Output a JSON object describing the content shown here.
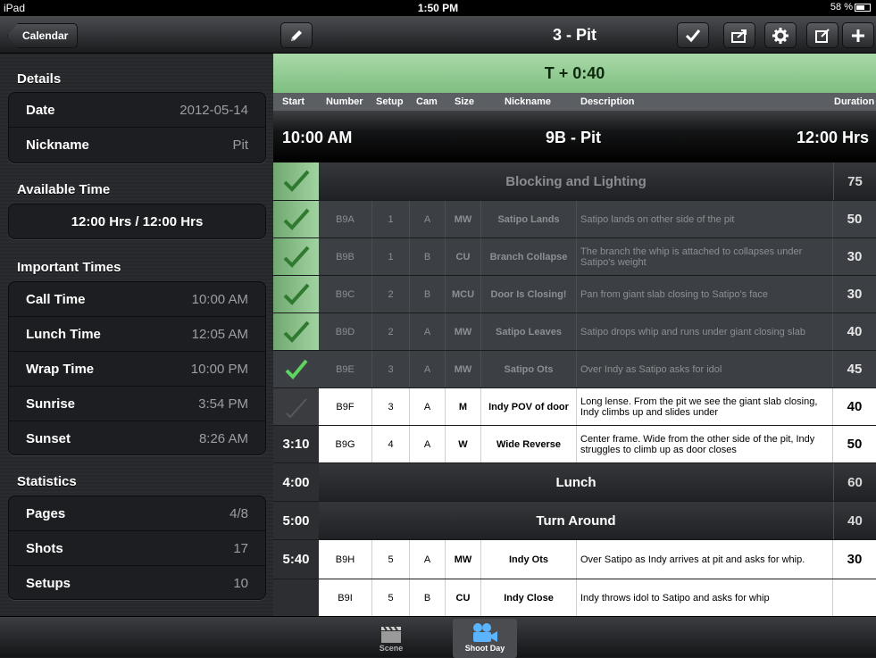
{
  "status": {
    "device": "iPad",
    "time": "1:50 PM",
    "battery": "58 %"
  },
  "sidebar": {
    "back_label": "Calendar",
    "details_header": "Details",
    "details": [
      {
        "label": "Date",
        "value": "2012-05-14"
      },
      {
        "label": "Nickname",
        "value": "Pit"
      }
    ],
    "available_header": "Available Time",
    "available_value": "12:00 Hrs  /  12:00 Hrs",
    "important_header": "Important Times",
    "important": [
      {
        "label": "Call Time",
        "value": "10:00 AM"
      },
      {
        "label": "Lunch Time",
        "value": "12:05 AM"
      },
      {
        "label": "Wrap Time",
        "value": "10:00 PM"
      },
      {
        "label": "Sunrise",
        "value": "3:54 PM"
      },
      {
        "label": "Sunset",
        "value": "8:26 AM"
      }
    ],
    "stats_header": "Statistics",
    "stats": [
      {
        "label": "Pages",
        "value": "4/8"
      },
      {
        "label": "Shots",
        "value": "17"
      },
      {
        "label": "Setups",
        "value": "10"
      }
    ]
  },
  "main": {
    "title": "3 - Pit",
    "timer": "T + 0:40",
    "columns": {
      "start": "Start",
      "number": "Number",
      "setup": "Setup",
      "cam": "Cam",
      "size": "Size",
      "nickname": "Nickname",
      "description": "Description",
      "duration": "Duration"
    },
    "day": {
      "start": "10:00 AM",
      "scene": "9B - Pit",
      "duration": "12:00 Hrs"
    },
    "band_blocking": {
      "label": "Blocking and Lighting",
      "duration": "75"
    },
    "shots": [
      {
        "number": "B9A",
        "setup": "1",
        "cam": "A",
        "size": "MW",
        "nickname": "Satipo Lands",
        "description": "Satipo lands on other side of the pit",
        "duration": "50"
      },
      {
        "number": "B9B",
        "setup": "1",
        "cam": "B",
        "size": "CU",
        "nickname": "Branch Collapse",
        "description": "The branch the whip is attached to collapses under Satipo's weight",
        "duration": "30"
      },
      {
        "number": "B9C",
        "setup": "2",
        "cam": "B",
        "size": "MCU",
        "nickname": "Door Is Closing!",
        "description": "Pan from giant slab closing to Satipo's face",
        "duration": "30"
      },
      {
        "number": "B9D",
        "setup": "2",
        "cam": "A",
        "size": "MW",
        "nickname": "Satipo Leaves",
        "description": "Satipo drops whip and runs under giant closing slab",
        "duration": "40"
      },
      {
        "number": "B9E",
        "setup": "3",
        "cam": "A",
        "size": "MW",
        "nickname": "Satipo Ots",
        "description": "Over Indy as Satipo asks for idol",
        "duration": "45"
      },
      {
        "number": "B9F",
        "setup": "3",
        "cam": "A",
        "size": "M",
        "nickname": "Indy POV of door",
        "description": "Long lense. From the pit we see the giant slab closing, Indy climbs up and slides under",
        "duration": "40"
      },
      {
        "start": "3:10",
        "number": "B9G",
        "setup": "4",
        "cam": "A",
        "size": "W",
        "nickname": "Wide Reverse",
        "description": "Center frame. Wide from the other side of the pit, Indy struggles to climb up as door closes",
        "duration": "50"
      },
      {
        "start": "5:40",
        "number": "B9H",
        "setup": "5",
        "cam": "A",
        "size": "MW",
        "nickname": "Indy Ots",
        "description": "Over Satipo as Indy arrives at pit and asks for whip.",
        "duration": "30"
      },
      {
        "number": "B9I",
        "setup": "5",
        "cam": "B",
        "size": "CU",
        "nickname": "Indy Close",
        "description": "Indy throws idol to Satipo and asks for whip",
        "duration": ""
      }
    ],
    "band_lunch": {
      "start": "4:00",
      "label": "Lunch",
      "duration": "60"
    },
    "band_turn": {
      "start": "5:00",
      "label": "Turn Around",
      "duration": "40"
    }
  },
  "tabs": [
    {
      "label": "Scene"
    },
    {
      "label": "Shoot Day"
    }
  ]
}
